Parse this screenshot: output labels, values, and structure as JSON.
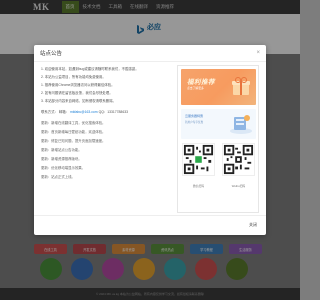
{
  "header": {
    "brand": "MK",
    "nav": [
      "首页",
      "技术文档",
      "工具箱",
      "在线翻译",
      "资源推荐"
    ]
  },
  "hero": {
    "logo_text": "必应"
  },
  "modal": {
    "title": "站点公告",
    "close_label": "关闭",
    "paragraphs": [
      "1. 欢迎使用本站，如遇到bug或建议请随时联系我们，不胜感激。",
      "2. 本站为公益项目，所有功能均免费使用。",
      "    1. 推荐使用Chrome浏览器访问以获得最佳体验。",
      "    2. 如有问题请在留言板反馈，我们会尽快处理。",
      "3. 本站部分内容来自网络，如有侵权请联系删除。"
    ],
    "contact_label": "联系方式：",
    "contact_email_label": "邮箱：",
    "contact_email": "mkfabu@163.com",
    "contact_qq": "QQ：13317788633",
    "updates": [
      "更新：新增在线翻译工具，优化搜索体验。",
      "更新：首页新增每日壁纸功能，欢迎体验。",
      "更新：修复已知问题，提升页面加载速度。",
      "更新：新增站点公告功能。",
      "更新：新增资源推荐版块。",
      "更新：优化移动端显示效果。",
      "更新：站点正式上线。"
    ],
    "ad1_title": "福利推荐",
    "ad1_sub": "点击了解更多",
    "ad2_title": "云服务器特惠",
    "ad2_sub": "新用户专享优惠",
    "qr_caption_left": "微信扫码",
    "qr_caption_right": "Weibo扫码"
  },
  "grid": {
    "tiles": [
      "在线工具",
      "开发文档",
      "素材资源",
      "资讯热点",
      "学习教程",
      "生活服务"
    ]
  },
  "footer": {
    "text": "© 2024 MK.us.kg 本站为公益网站，所有内容仅供学习交流，如有侵权请联系删除"
  },
  "colors": {
    "accent_green": "#5a7a2c",
    "link_blue": "#1a7ed6",
    "banner_orange": "#f6a36b"
  }
}
